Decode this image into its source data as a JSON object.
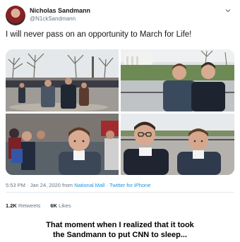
{
  "tweet": {
    "author": {
      "display_name": "Nicholas Sandmann",
      "handle": "@N1ckSandmann"
    },
    "text": "I will never pass on an opportunity to March for Life!",
    "timestamp": "5:53 PM · Jan 24, 2020 from ",
    "location": "National Mall",
    "separator": " · ",
    "source": "Twitter for iPhone",
    "retweets_count": "1.2K",
    "retweets_label": "Retweets",
    "likes_count": "6K",
    "likes_label": "Likes"
  },
  "caption": {
    "line1": "That moment when I realized that it took",
    "line2": "the Sandmann to put CNN to sleep..."
  },
  "icons": {
    "menu": "chevron-down-icon"
  }
}
